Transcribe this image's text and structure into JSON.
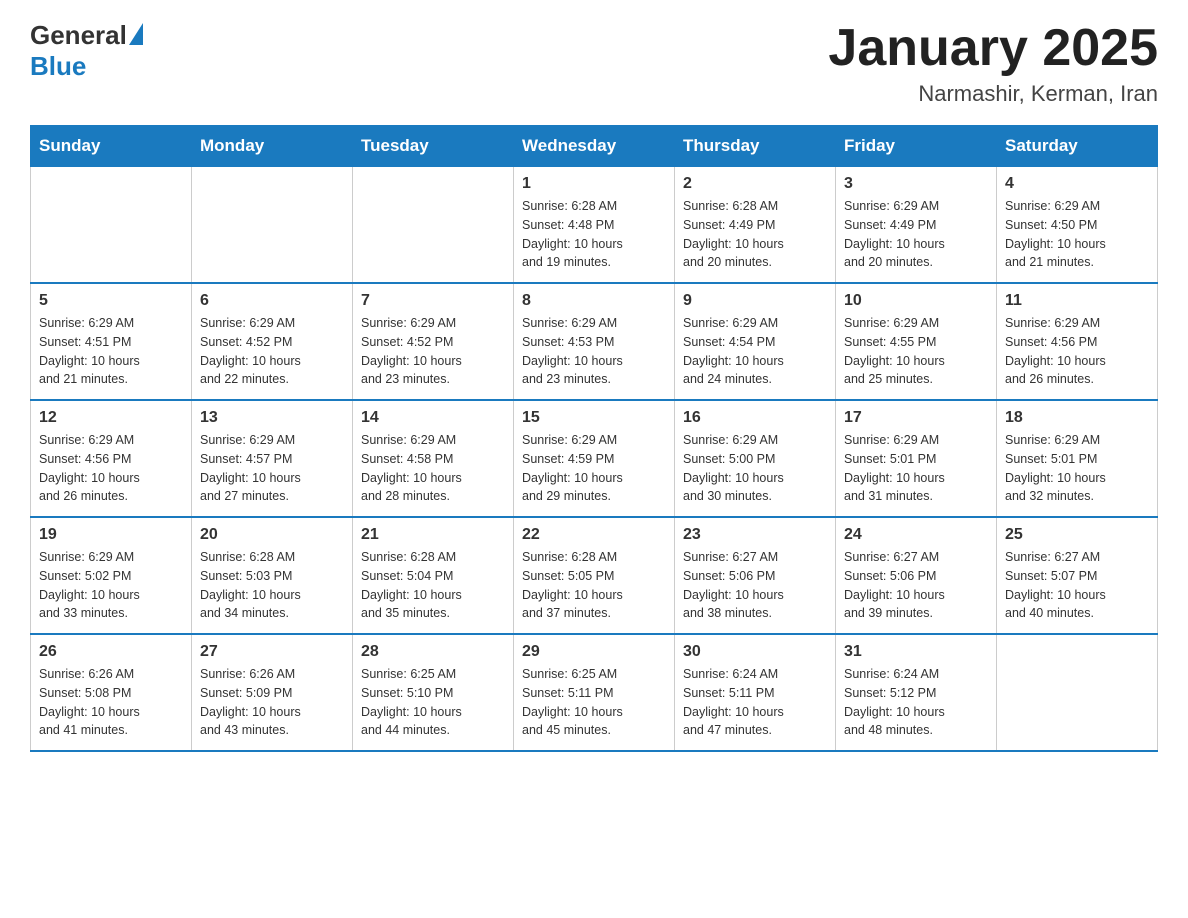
{
  "header": {
    "logo_general": "General",
    "logo_blue": "Blue",
    "title": "January 2025",
    "subtitle": "Narmashir, Kerman, Iran"
  },
  "days_of_week": [
    "Sunday",
    "Monday",
    "Tuesday",
    "Wednesday",
    "Thursday",
    "Friday",
    "Saturday"
  ],
  "weeks": [
    {
      "days": [
        {
          "number": "",
          "info": ""
        },
        {
          "number": "",
          "info": ""
        },
        {
          "number": "",
          "info": ""
        },
        {
          "number": "1",
          "info": "Sunrise: 6:28 AM\nSunset: 4:48 PM\nDaylight: 10 hours\nand 19 minutes."
        },
        {
          "number": "2",
          "info": "Sunrise: 6:28 AM\nSunset: 4:49 PM\nDaylight: 10 hours\nand 20 minutes."
        },
        {
          "number": "3",
          "info": "Sunrise: 6:29 AM\nSunset: 4:49 PM\nDaylight: 10 hours\nand 20 minutes."
        },
        {
          "number": "4",
          "info": "Sunrise: 6:29 AM\nSunset: 4:50 PM\nDaylight: 10 hours\nand 21 minutes."
        }
      ]
    },
    {
      "days": [
        {
          "number": "5",
          "info": "Sunrise: 6:29 AM\nSunset: 4:51 PM\nDaylight: 10 hours\nand 21 minutes."
        },
        {
          "number": "6",
          "info": "Sunrise: 6:29 AM\nSunset: 4:52 PM\nDaylight: 10 hours\nand 22 minutes."
        },
        {
          "number": "7",
          "info": "Sunrise: 6:29 AM\nSunset: 4:52 PM\nDaylight: 10 hours\nand 23 minutes."
        },
        {
          "number": "8",
          "info": "Sunrise: 6:29 AM\nSunset: 4:53 PM\nDaylight: 10 hours\nand 23 minutes."
        },
        {
          "number": "9",
          "info": "Sunrise: 6:29 AM\nSunset: 4:54 PM\nDaylight: 10 hours\nand 24 minutes."
        },
        {
          "number": "10",
          "info": "Sunrise: 6:29 AM\nSunset: 4:55 PM\nDaylight: 10 hours\nand 25 minutes."
        },
        {
          "number": "11",
          "info": "Sunrise: 6:29 AM\nSunset: 4:56 PM\nDaylight: 10 hours\nand 26 minutes."
        }
      ]
    },
    {
      "days": [
        {
          "number": "12",
          "info": "Sunrise: 6:29 AM\nSunset: 4:56 PM\nDaylight: 10 hours\nand 26 minutes."
        },
        {
          "number": "13",
          "info": "Sunrise: 6:29 AM\nSunset: 4:57 PM\nDaylight: 10 hours\nand 27 minutes."
        },
        {
          "number": "14",
          "info": "Sunrise: 6:29 AM\nSunset: 4:58 PM\nDaylight: 10 hours\nand 28 minutes."
        },
        {
          "number": "15",
          "info": "Sunrise: 6:29 AM\nSunset: 4:59 PM\nDaylight: 10 hours\nand 29 minutes."
        },
        {
          "number": "16",
          "info": "Sunrise: 6:29 AM\nSunset: 5:00 PM\nDaylight: 10 hours\nand 30 minutes."
        },
        {
          "number": "17",
          "info": "Sunrise: 6:29 AM\nSunset: 5:01 PM\nDaylight: 10 hours\nand 31 minutes."
        },
        {
          "number": "18",
          "info": "Sunrise: 6:29 AM\nSunset: 5:01 PM\nDaylight: 10 hours\nand 32 minutes."
        }
      ]
    },
    {
      "days": [
        {
          "number": "19",
          "info": "Sunrise: 6:29 AM\nSunset: 5:02 PM\nDaylight: 10 hours\nand 33 minutes."
        },
        {
          "number": "20",
          "info": "Sunrise: 6:28 AM\nSunset: 5:03 PM\nDaylight: 10 hours\nand 34 minutes."
        },
        {
          "number": "21",
          "info": "Sunrise: 6:28 AM\nSunset: 5:04 PM\nDaylight: 10 hours\nand 35 minutes."
        },
        {
          "number": "22",
          "info": "Sunrise: 6:28 AM\nSunset: 5:05 PM\nDaylight: 10 hours\nand 37 minutes."
        },
        {
          "number": "23",
          "info": "Sunrise: 6:27 AM\nSunset: 5:06 PM\nDaylight: 10 hours\nand 38 minutes."
        },
        {
          "number": "24",
          "info": "Sunrise: 6:27 AM\nSunset: 5:06 PM\nDaylight: 10 hours\nand 39 minutes."
        },
        {
          "number": "25",
          "info": "Sunrise: 6:27 AM\nSunset: 5:07 PM\nDaylight: 10 hours\nand 40 minutes."
        }
      ]
    },
    {
      "days": [
        {
          "number": "26",
          "info": "Sunrise: 6:26 AM\nSunset: 5:08 PM\nDaylight: 10 hours\nand 41 minutes."
        },
        {
          "number": "27",
          "info": "Sunrise: 6:26 AM\nSunset: 5:09 PM\nDaylight: 10 hours\nand 43 minutes."
        },
        {
          "number": "28",
          "info": "Sunrise: 6:25 AM\nSunset: 5:10 PM\nDaylight: 10 hours\nand 44 minutes."
        },
        {
          "number": "29",
          "info": "Sunrise: 6:25 AM\nSunset: 5:11 PM\nDaylight: 10 hours\nand 45 minutes."
        },
        {
          "number": "30",
          "info": "Sunrise: 6:24 AM\nSunset: 5:11 PM\nDaylight: 10 hours\nand 47 minutes."
        },
        {
          "number": "31",
          "info": "Sunrise: 6:24 AM\nSunset: 5:12 PM\nDaylight: 10 hours\nand 48 minutes."
        },
        {
          "number": "",
          "info": ""
        }
      ]
    }
  ]
}
